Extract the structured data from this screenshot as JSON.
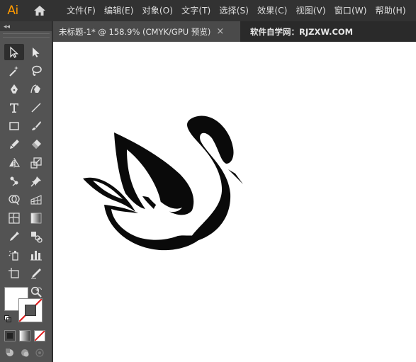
{
  "app": {
    "logo_text": "Ai"
  },
  "menu": {
    "items": [
      "文件(F)",
      "编辑(E)",
      "对象(O)",
      "文字(T)",
      "选择(S)",
      "效果(C)",
      "视图(V)",
      "窗口(W)",
      "帮助(H)"
    ]
  },
  "tabs": {
    "active_title": "未标题-1* @ 158.9% (CMYK/GPU 预览)",
    "close_glyph": "×",
    "extra_text": "软件自学网：RJZXW.COM"
  },
  "toolbar": {
    "collapse_glyph": "◂◂",
    "swap_glyph": "↶",
    "tools": [
      {
        "name": "selection-tool-icon",
        "selected": true
      },
      {
        "name": "direct-selection-tool-icon"
      },
      {
        "name": "magic-wand-tool-icon"
      },
      {
        "name": "lasso-tool-icon"
      },
      {
        "name": "pen-tool-icon"
      },
      {
        "name": "curvature-tool-icon"
      },
      {
        "name": "type-tool-icon"
      },
      {
        "name": "line-segment-tool-icon"
      },
      {
        "name": "rectangle-tool-icon"
      },
      {
        "name": "paintbrush-tool-icon"
      },
      {
        "name": "shaper-tool-icon"
      },
      {
        "name": "eraser-tool-icon"
      },
      {
        "name": "reflect-tool-icon"
      },
      {
        "name": "scale-tool-icon"
      },
      {
        "name": "puppet-warp-tool-icon"
      },
      {
        "name": "free-transform-pin-icon"
      },
      {
        "name": "shape-builder-tool-icon"
      },
      {
        "name": "perspective-grid-tool-icon"
      },
      {
        "name": "mesh-tool-icon"
      },
      {
        "name": "gradient-tool-icon"
      },
      {
        "name": "eyedropper-tool-icon"
      },
      {
        "name": "blend-tool-icon"
      },
      {
        "name": "symbol-sprayer-tool-icon"
      },
      {
        "name": "column-graph-tool-icon"
      },
      {
        "name": "artboard-tool-icon"
      },
      {
        "name": "slice-tool-icon"
      },
      {
        "name": "hand-tool-icon"
      },
      {
        "name": "zoom-tool-icon"
      }
    ]
  }
}
